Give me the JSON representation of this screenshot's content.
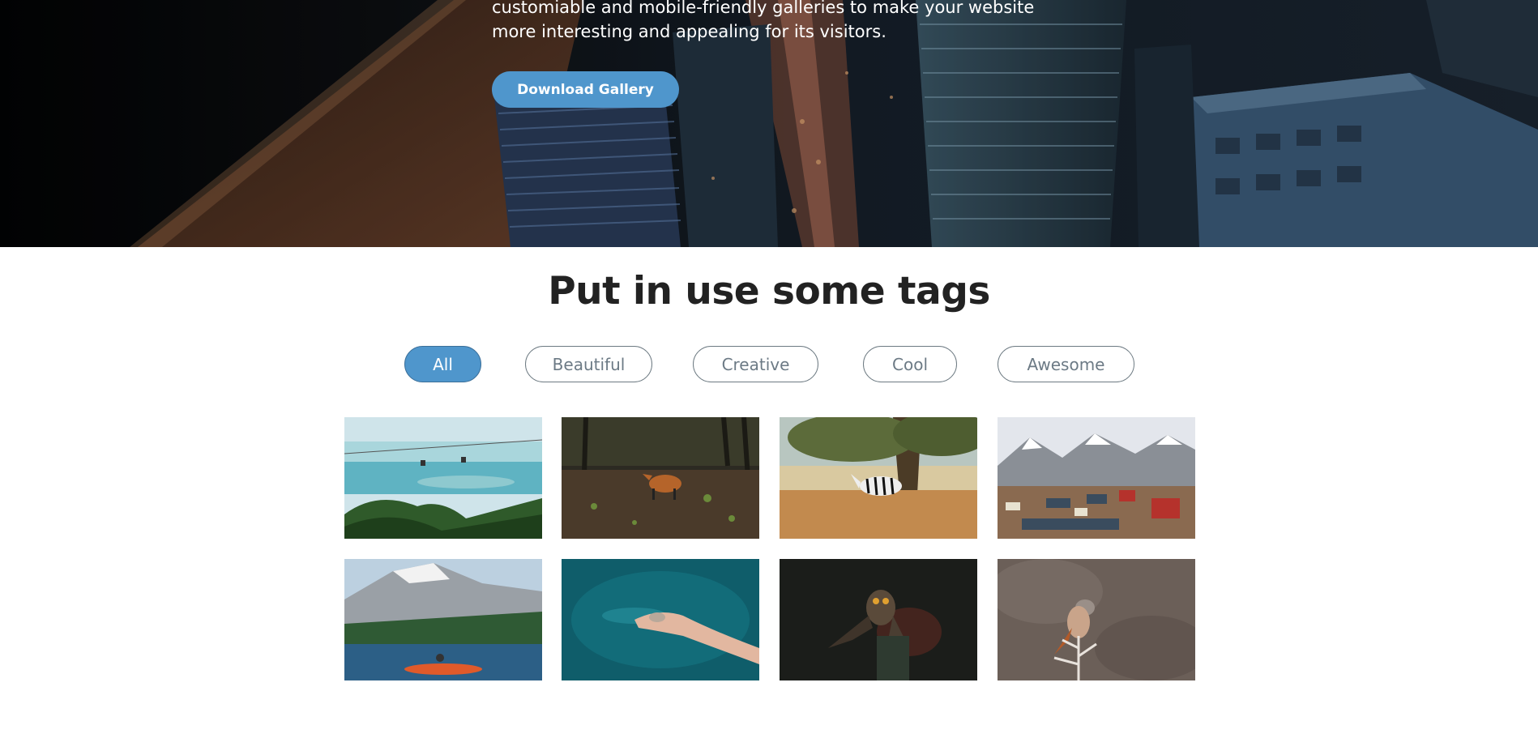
{
  "hero": {
    "line1": "customiable and mobile-friendly galleries to make your website",
    "line2": "more interesting and appealing for its visitors.",
    "download_label": "Download Gallery"
  },
  "section": {
    "title": "Put in use some tags"
  },
  "tags": [
    {
      "label": "All",
      "active": true
    },
    {
      "label": "Beautiful",
      "active": false
    },
    {
      "label": "Creative",
      "active": false
    },
    {
      "label": "Cool",
      "active": false
    },
    {
      "label": "Awesome",
      "active": false
    }
  ],
  "gallery": [
    {
      "subject": "lake-cable-car-photo"
    },
    {
      "subject": "fox-forest-photo"
    },
    {
      "subject": "zebra-savanna-photo"
    },
    {
      "subject": "mountain-village-photo"
    },
    {
      "subject": "kayak-mountain-lake-photo"
    },
    {
      "subject": "hand-in-water-photo"
    },
    {
      "subject": "owl-on-glove-photo"
    },
    {
      "subject": "bird-on-branch-photo"
    }
  ],
  "colors": {
    "accent": "#4f96cc",
    "title": "#222222",
    "tag_text": "#6c7a85"
  }
}
